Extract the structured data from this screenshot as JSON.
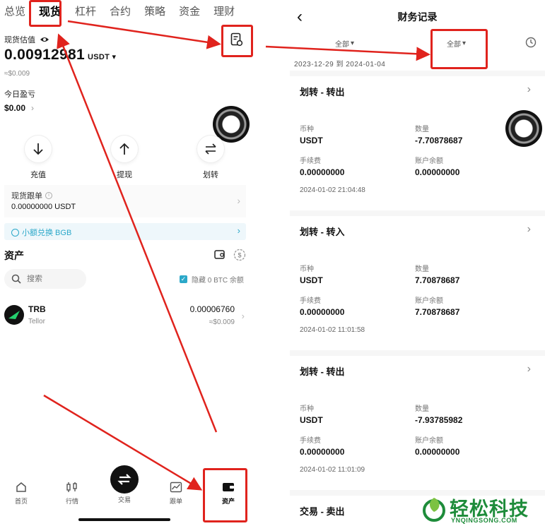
{
  "colors": {
    "accent": "#2ba8c9",
    "annotation": "#e0231d",
    "brand": "#1e8c3a"
  },
  "spot": {
    "tabs": [
      "总览",
      "现货",
      "杠杆",
      "合约",
      "策略",
      "资金",
      "理财"
    ],
    "active_tab": "现货",
    "estimate_label": "现货估值",
    "estimate_value": "0.00912981",
    "estimate_unit": "USDT",
    "estimate_approx": "≈$0.009",
    "pnl_label": "今日盈亏",
    "pnl_value": "$0.00",
    "actions": [
      {
        "label": "充值",
        "icon": "arrow-down-icon"
      },
      {
        "label": "提现",
        "icon": "arrow-up-icon"
      },
      {
        "label": "划转",
        "icon": "transfer-icon"
      }
    ],
    "copy_trade_label": "现货跟单",
    "copy_trade_value": "0.00000000 USDT",
    "bgb_label": "小额兑换 BGB",
    "assets_title": "资产",
    "search_placeholder": "搜索",
    "hide_zero_label": "隐藏 0 BTC 余额",
    "coins": [
      {
        "symbol": "TRB",
        "name": "Tellor",
        "amount": "0.00006760",
        "fiat": "≈$0.009"
      }
    ],
    "bottom_nav": [
      {
        "label": "首页",
        "icon": "home-icon"
      },
      {
        "label": "行情",
        "icon": "candlestick-icon"
      },
      {
        "label": "交易",
        "icon": "trade-icon"
      },
      {
        "label": "跟单",
        "icon": "copy-chart-icon"
      },
      {
        "label": "资产",
        "icon": "wallet-icon"
      }
    ]
  },
  "records": {
    "title": "财务记录",
    "filter_left": "全部",
    "filter_right": "全部",
    "date_start": "2023-12-29",
    "date_sep": "到",
    "date_end": "2024-01-04",
    "field_labels": {
      "currency": "币种",
      "amount": "数量",
      "fee": "手续费",
      "balance": "账户余额"
    },
    "entries": [
      {
        "type": "划转 - 转出",
        "currency": "USDT",
        "amount": "-7.70878687",
        "fee": "0.00000000",
        "balance": "0.00000000",
        "time": "2024-01-02 21:04:48"
      },
      {
        "type": "划转 - 转入",
        "currency": "USDT",
        "amount": "7.70878687",
        "fee": "0.00000000",
        "balance": "7.70878687",
        "time": "2024-01-02 11:01:58"
      },
      {
        "type": "划转 - 转出",
        "currency": "USDT",
        "amount": "-7.93785982",
        "fee": "0.00000000",
        "balance": "0.00000000",
        "time": "2024-01-02 11:01:09"
      },
      {
        "type": "交易 - 卖出"
      }
    ]
  },
  "watermark": {
    "name": "轻松科技",
    "url": "YNQINGSONG.COM"
  }
}
